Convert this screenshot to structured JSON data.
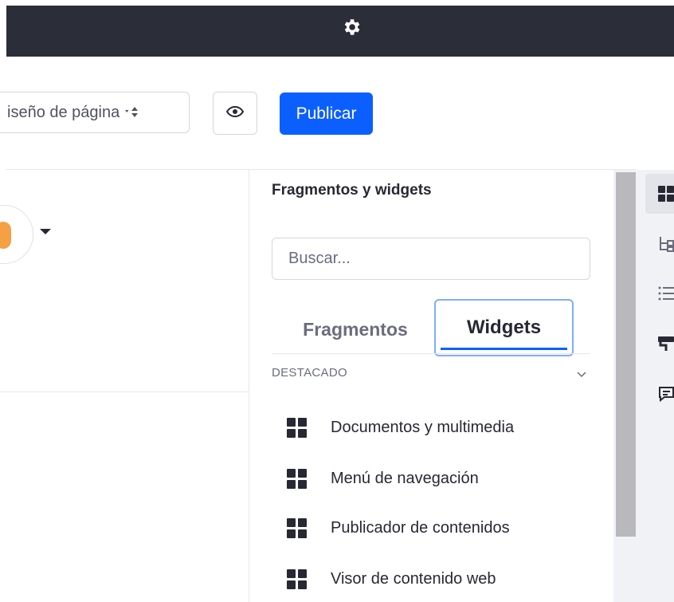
{
  "toolbar": {
    "layout_select_label": "iseño de página",
    "publish_label": "Publicar"
  },
  "sidebar": {
    "title": "Fragmentos y widgets",
    "search": {
      "placeholder": "Buscar...",
      "value": ""
    },
    "tabs": [
      {
        "label": "Fragmentos",
        "active": false
      },
      {
        "label": "Widgets",
        "active": true
      }
    ],
    "section": {
      "label": "DESTACADO",
      "items": [
        {
          "label": "Documentos y multimedia",
          "icon": "grid-icon"
        },
        {
          "label": "Menú de navegación",
          "icon": "grid-icon"
        },
        {
          "label": "Publicador de contenidos",
          "icon": "grid-icon"
        },
        {
          "label": "Visor de contenido web",
          "icon": "grid-icon"
        }
      ]
    }
  },
  "rail": {
    "icons": [
      "widgets-grid-icon",
      "page-structure-icon",
      "list-icon",
      "paint-roller-icon",
      "comments-icon"
    ]
  },
  "colors": {
    "topbar": "#2b2d38",
    "primary": "#0b5fff",
    "text": "#272833",
    "muted": "#6b6c7e"
  }
}
